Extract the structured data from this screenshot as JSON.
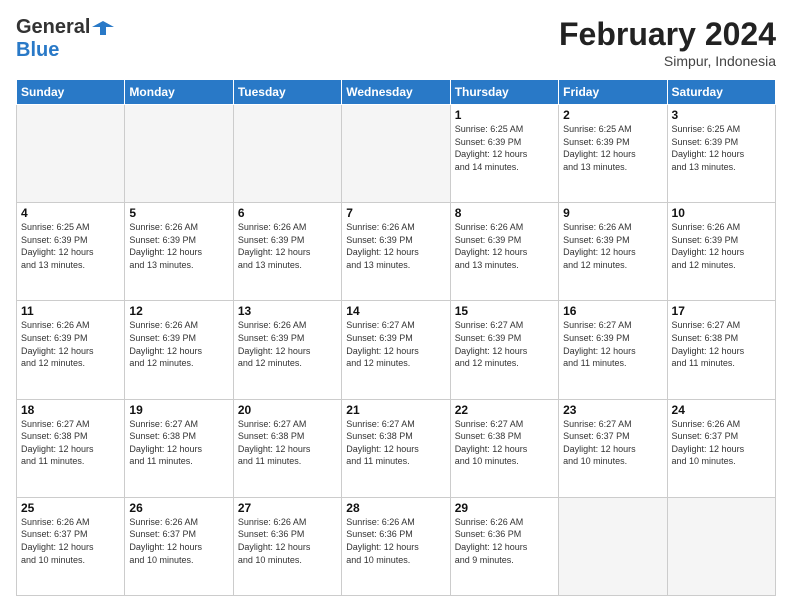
{
  "header": {
    "logo_general": "General",
    "logo_blue": "Blue",
    "month_title": "February 2024",
    "subtitle": "Simpur, Indonesia"
  },
  "days_of_week": [
    "Sunday",
    "Monday",
    "Tuesday",
    "Wednesday",
    "Thursday",
    "Friday",
    "Saturday"
  ],
  "weeks": [
    [
      {
        "day": "",
        "info": "",
        "empty": true
      },
      {
        "day": "",
        "info": "",
        "empty": true
      },
      {
        "day": "",
        "info": "",
        "empty": true
      },
      {
        "day": "",
        "info": "",
        "empty": true
      },
      {
        "day": "1",
        "info": "Sunrise: 6:25 AM\nSunset: 6:39 PM\nDaylight: 12 hours\nand 14 minutes."
      },
      {
        "day": "2",
        "info": "Sunrise: 6:25 AM\nSunset: 6:39 PM\nDaylight: 12 hours\nand 13 minutes."
      },
      {
        "day": "3",
        "info": "Sunrise: 6:25 AM\nSunset: 6:39 PM\nDaylight: 12 hours\nand 13 minutes."
      }
    ],
    [
      {
        "day": "4",
        "info": "Sunrise: 6:25 AM\nSunset: 6:39 PM\nDaylight: 12 hours\nand 13 minutes."
      },
      {
        "day": "5",
        "info": "Sunrise: 6:26 AM\nSunset: 6:39 PM\nDaylight: 12 hours\nand 13 minutes."
      },
      {
        "day": "6",
        "info": "Sunrise: 6:26 AM\nSunset: 6:39 PM\nDaylight: 12 hours\nand 13 minutes."
      },
      {
        "day": "7",
        "info": "Sunrise: 6:26 AM\nSunset: 6:39 PM\nDaylight: 12 hours\nand 13 minutes."
      },
      {
        "day": "8",
        "info": "Sunrise: 6:26 AM\nSunset: 6:39 PM\nDaylight: 12 hours\nand 13 minutes."
      },
      {
        "day": "9",
        "info": "Sunrise: 6:26 AM\nSunset: 6:39 PM\nDaylight: 12 hours\nand 12 minutes."
      },
      {
        "day": "10",
        "info": "Sunrise: 6:26 AM\nSunset: 6:39 PM\nDaylight: 12 hours\nand 12 minutes."
      }
    ],
    [
      {
        "day": "11",
        "info": "Sunrise: 6:26 AM\nSunset: 6:39 PM\nDaylight: 12 hours\nand 12 minutes."
      },
      {
        "day": "12",
        "info": "Sunrise: 6:26 AM\nSunset: 6:39 PM\nDaylight: 12 hours\nand 12 minutes."
      },
      {
        "day": "13",
        "info": "Sunrise: 6:26 AM\nSunset: 6:39 PM\nDaylight: 12 hours\nand 12 minutes."
      },
      {
        "day": "14",
        "info": "Sunrise: 6:27 AM\nSunset: 6:39 PM\nDaylight: 12 hours\nand 12 minutes."
      },
      {
        "day": "15",
        "info": "Sunrise: 6:27 AM\nSunset: 6:39 PM\nDaylight: 12 hours\nand 12 minutes."
      },
      {
        "day": "16",
        "info": "Sunrise: 6:27 AM\nSunset: 6:39 PM\nDaylight: 12 hours\nand 11 minutes."
      },
      {
        "day": "17",
        "info": "Sunrise: 6:27 AM\nSunset: 6:38 PM\nDaylight: 12 hours\nand 11 minutes."
      }
    ],
    [
      {
        "day": "18",
        "info": "Sunrise: 6:27 AM\nSunset: 6:38 PM\nDaylight: 12 hours\nand 11 minutes."
      },
      {
        "day": "19",
        "info": "Sunrise: 6:27 AM\nSunset: 6:38 PM\nDaylight: 12 hours\nand 11 minutes."
      },
      {
        "day": "20",
        "info": "Sunrise: 6:27 AM\nSunset: 6:38 PM\nDaylight: 12 hours\nand 11 minutes."
      },
      {
        "day": "21",
        "info": "Sunrise: 6:27 AM\nSunset: 6:38 PM\nDaylight: 12 hours\nand 11 minutes."
      },
      {
        "day": "22",
        "info": "Sunrise: 6:27 AM\nSunset: 6:38 PM\nDaylight: 12 hours\nand 10 minutes."
      },
      {
        "day": "23",
        "info": "Sunrise: 6:27 AM\nSunset: 6:37 PM\nDaylight: 12 hours\nand 10 minutes."
      },
      {
        "day": "24",
        "info": "Sunrise: 6:26 AM\nSunset: 6:37 PM\nDaylight: 12 hours\nand 10 minutes."
      }
    ],
    [
      {
        "day": "25",
        "info": "Sunrise: 6:26 AM\nSunset: 6:37 PM\nDaylight: 12 hours\nand 10 minutes."
      },
      {
        "day": "26",
        "info": "Sunrise: 6:26 AM\nSunset: 6:37 PM\nDaylight: 12 hours\nand 10 minutes."
      },
      {
        "day": "27",
        "info": "Sunrise: 6:26 AM\nSunset: 6:36 PM\nDaylight: 12 hours\nand 10 minutes."
      },
      {
        "day": "28",
        "info": "Sunrise: 6:26 AM\nSunset: 6:36 PM\nDaylight: 12 hours\nand 10 minutes."
      },
      {
        "day": "29",
        "info": "Sunrise: 6:26 AM\nSunset: 6:36 PM\nDaylight: 12 hours\nand 9 minutes."
      },
      {
        "day": "",
        "info": "",
        "empty": true
      },
      {
        "day": "",
        "info": "",
        "empty": true
      }
    ]
  ]
}
